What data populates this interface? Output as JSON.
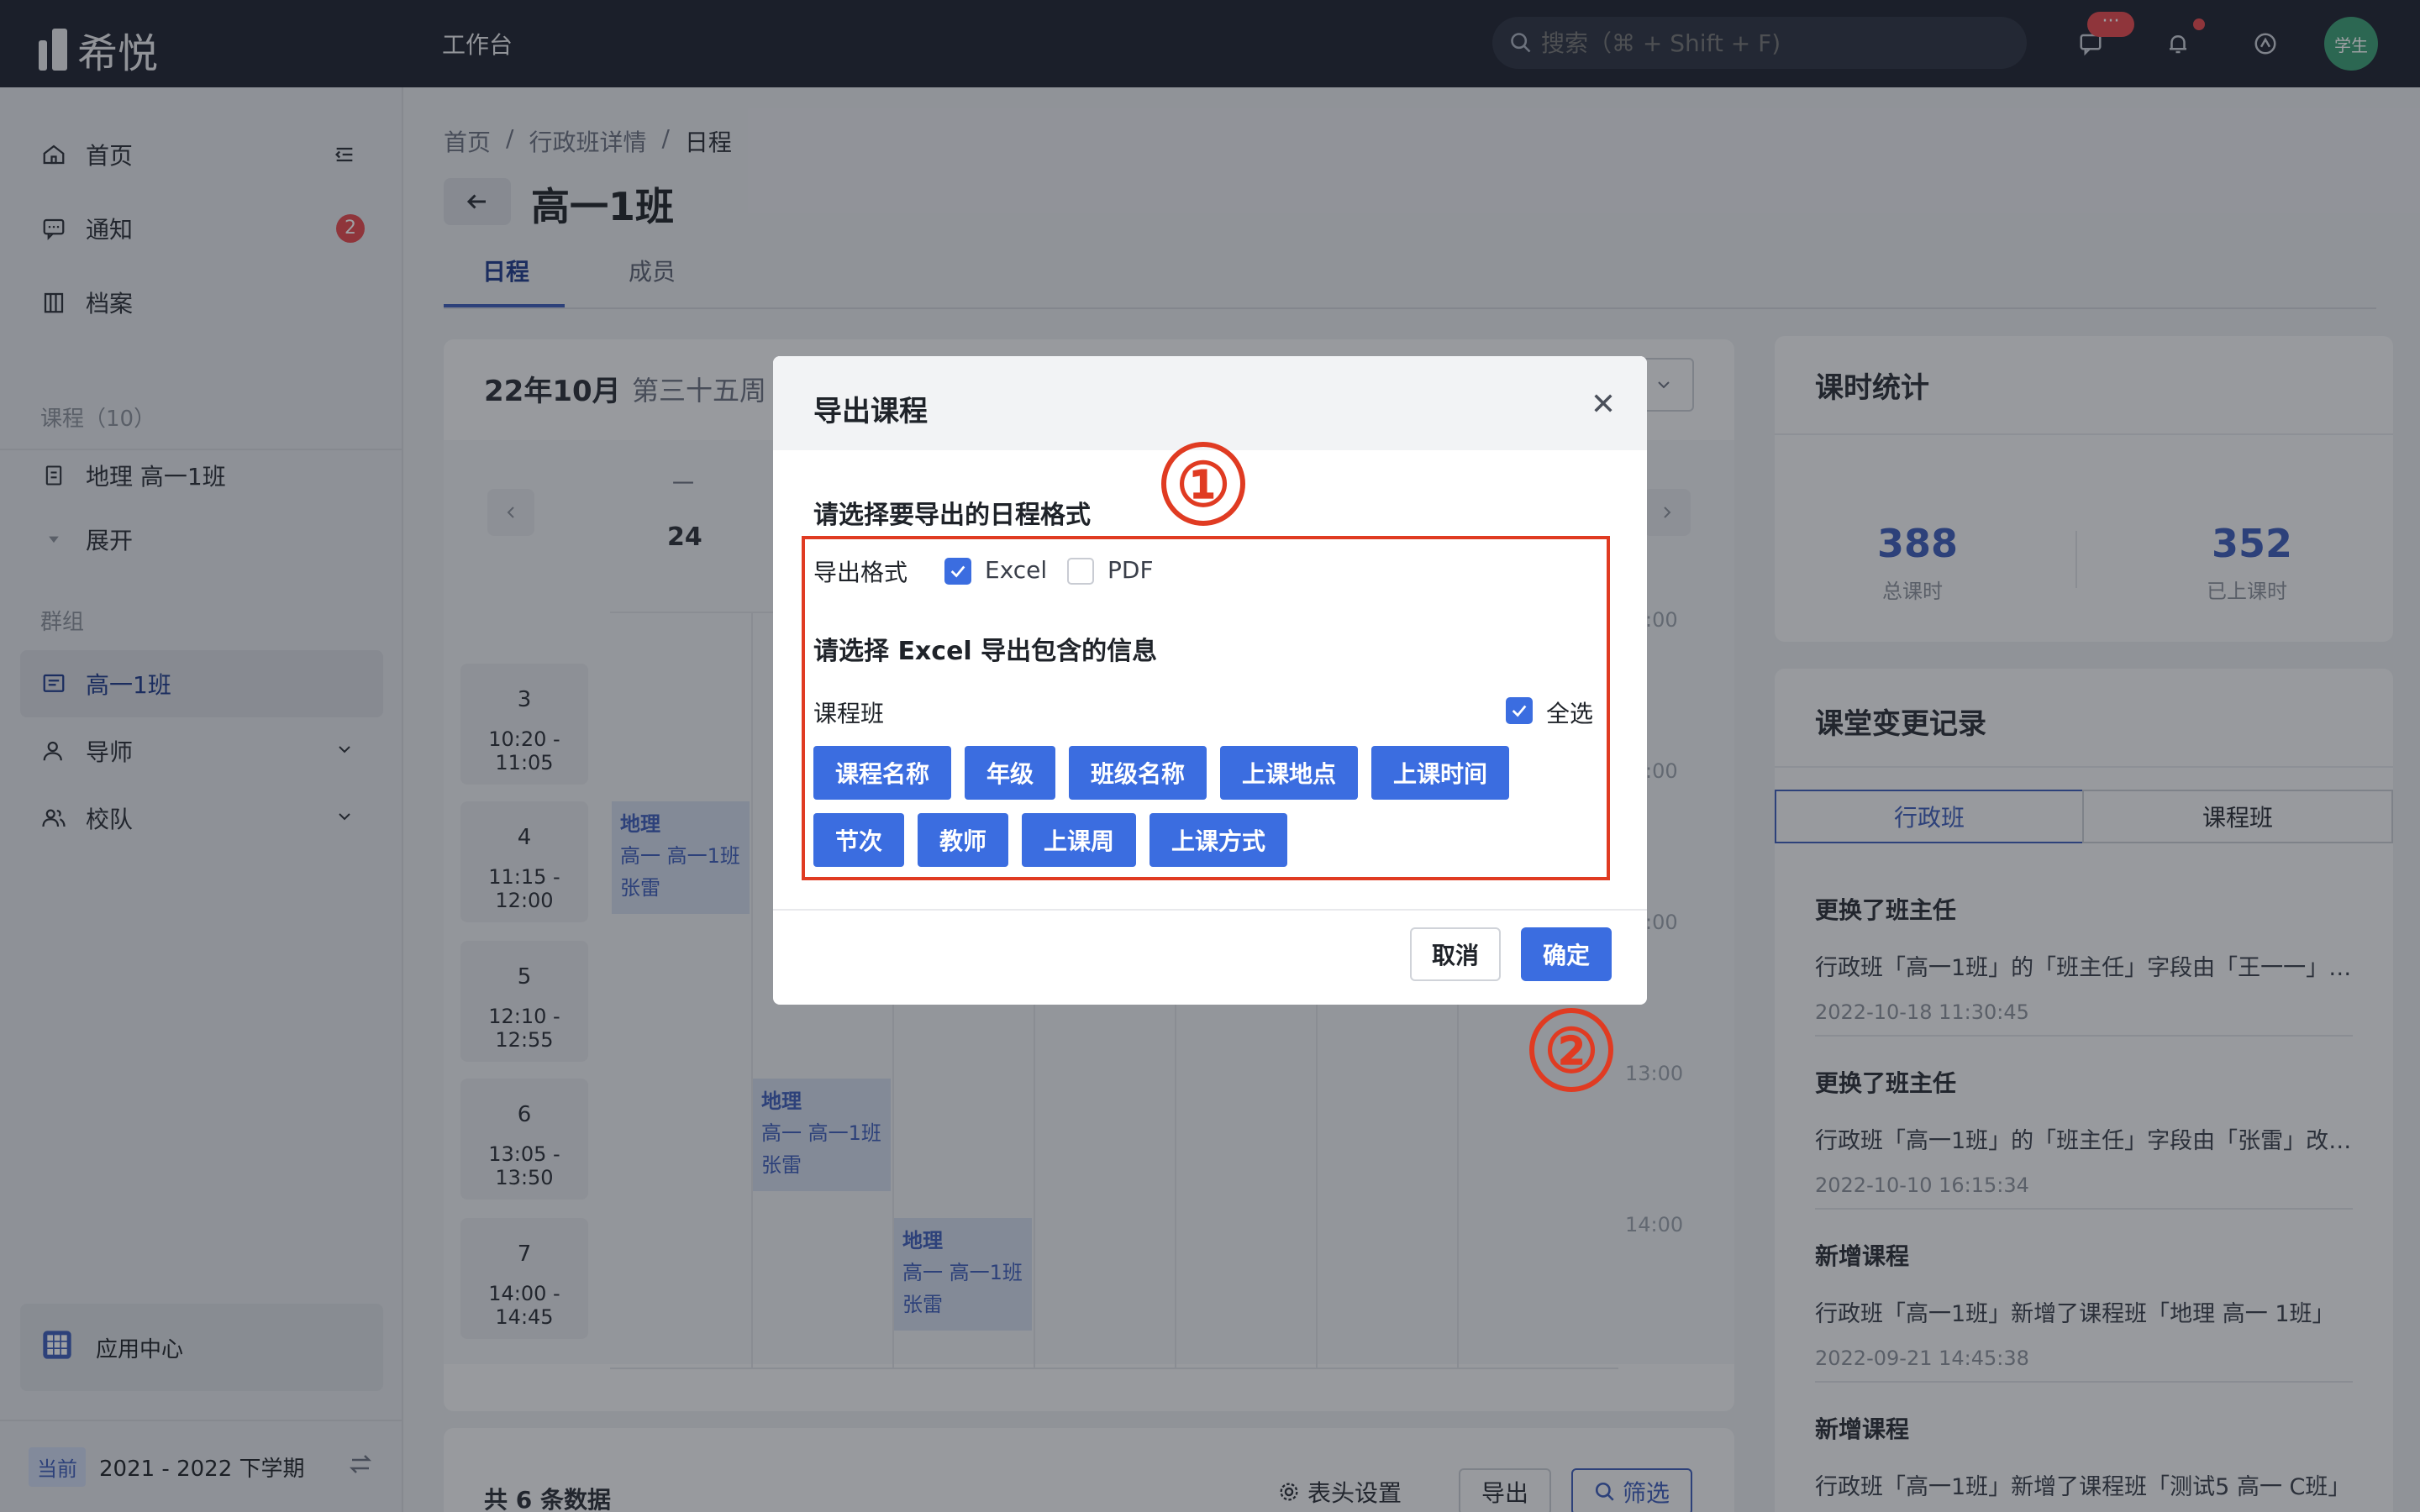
{
  "app": {
    "logo_text": "希悦",
    "nav_title": "工作台",
    "search_placeholder": "搜索（⌘ + Shift + F)",
    "msg_badge": "···",
    "avatar": "学生"
  },
  "sidebar": {
    "items": [
      {
        "label": "首页"
      },
      {
        "label": "通知",
        "badge": "2"
      },
      {
        "label": "档案"
      }
    ],
    "course_section": "课程（10）",
    "course_item": "地理 高一1班",
    "expand": "展开",
    "group_section": "群组",
    "group_items": [
      {
        "label": "高一1班"
      },
      {
        "label": "导师"
      },
      {
        "label": "校队"
      }
    ],
    "app_center": "应用中心",
    "current_tag": "当前",
    "semester": "2021 - 2022 下学期"
  },
  "page": {
    "breadcrumb": [
      "首页",
      "行政班详情",
      "日程"
    ],
    "title": "高一1班",
    "tabs": [
      "日程",
      "成员"
    ]
  },
  "calendar": {
    "month": "22年10月",
    "week": "第三十五周",
    "day_name": "一",
    "day_num": "24",
    "periods": [
      {
        "n": "3",
        "t": "10:20 - 11:05"
      },
      {
        "n": "4",
        "t": "11:15 - 12:00"
      },
      {
        "n": "5",
        "t": "12:10 - 12:55"
      },
      {
        "n": "6",
        "t": "13:05 - 13:50"
      },
      {
        "n": "7",
        "t": "14:00 - 14:45"
      }
    ],
    "lessons": [
      {
        "subject": "地理",
        "class": "高一  高一1班",
        "teacher": "张雷"
      },
      {
        "subject": "地理",
        "class": "高一  高一1班",
        "teacher": "张雷"
      },
      {
        "subject": "地理",
        "class": "高一  高一1班",
        "teacher": "张雷"
      }
    ],
    "time_labels": [
      ":00",
      ":00",
      ":00",
      "13:00",
      "14:00"
    ]
  },
  "stats": {
    "title": "课时统计",
    "total": "388",
    "total_label": "总课时",
    "done": "352",
    "done_label": "已上课时"
  },
  "changelog": {
    "title": "课堂变更记录",
    "seg": [
      "行政班",
      "课程班"
    ],
    "items": [
      {
        "h": "更换了班主任",
        "t": "行政班「高一1班」的「班主任」字段由「王一一」改…",
        "d": "2022-10-18 11:30:45"
      },
      {
        "h": "更换了班主任",
        "t": "行政班「高一1班」的「班主任」字段由「张雷」改为…",
        "d": "2022-10-10 16:15:34"
      },
      {
        "h": "新增课程",
        "t": "行政班「高一1班」新增了课程班「地理 高一 1班」",
        "d": "2022-09-21 14:45:38"
      },
      {
        "h": "新增课程",
        "t": "行政班「高一1班」新增了课程班「测试5 高一 C班」",
        "d": ""
      }
    ]
  },
  "table": {
    "total": "共 6 条数据",
    "header_settings": "表头设置",
    "export": "导出",
    "filter": "筛选"
  },
  "modal": {
    "title": "导出课程",
    "format_section": "请选择要导出的日程格式",
    "format_label": "导出格式",
    "formats": [
      {
        "label": "Excel",
        "checked": true
      },
      {
        "label": "PDF",
        "checked": false
      }
    ],
    "info_section": "请选择 Excel 导出包含的信息",
    "group_label": "课程班",
    "select_all": "全选",
    "chips_row1": [
      "课程名称",
      "年级",
      "班级名称",
      "上课地点",
      "上课时间"
    ],
    "chips_row2": [
      "节次",
      "教师",
      "上课周",
      "上课方式"
    ],
    "cancel": "取消",
    "ok": "确定"
  },
  "annotations": [
    "①",
    "②"
  ],
  "colors": {
    "primary": "#3b6de0",
    "annotation": "#e03b22",
    "topbar": "#1e2230"
  }
}
